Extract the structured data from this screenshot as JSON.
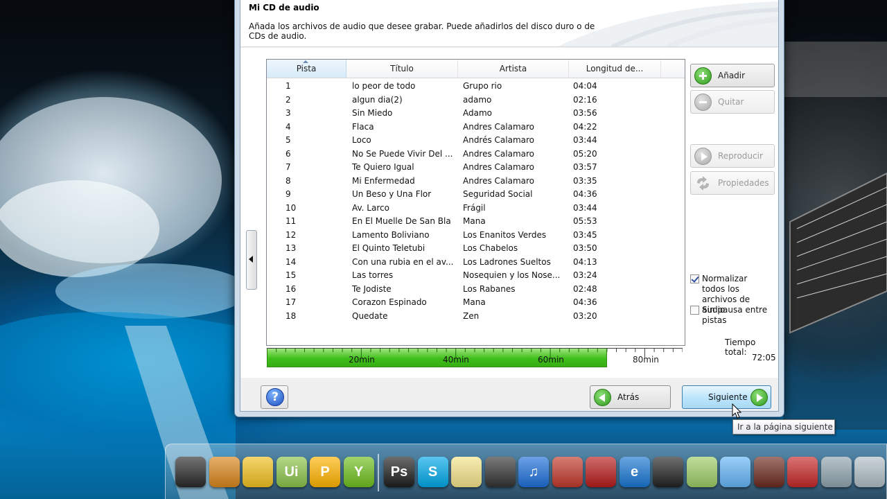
{
  "wizard": {
    "title": "Mi CD de audio",
    "description": "Añada los archivos de audio que desee grabar. Puede añadirlos del disco duro o de CDs de audio."
  },
  "track_list": {
    "columns": [
      "Pista",
      "Título",
      "Artista",
      "Longitud de..."
    ],
    "sorted_column": "Pista",
    "rows": [
      {
        "num": "1",
        "title": "lo peor de todo",
        "artist": "Grupo rio",
        "length": "04:04"
      },
      {
        "num": "2",
        "title": "algun dia(2)",
        "artist": "adamo",
        "length": "02:16"
      },
      {
        "num": "3",
        "title": "Sin Miedo",
        "artist": "Adamo",
        "length": "03:56"
      },
      {
        "num": "4",
        "title": "Flaca",
        "artist": "Andres Calamaro",
        "length": "04:22"
      },
      {
        "num": "5",
        "title": "Loco",
        "artist": "Andrés Calamaro",
        "length": "03:44"
      },
      {
        "num": "6",
        "title": "No Se Puede Vivir Del ...",
        "artist": "Andres Calamaro",
        "length": "05:20"
      },
      {
        "num": "7",
        "title": "Te Quiero Igual",
        "artist": "Andres Calamaro",
        "length": "03:57"
      },
      {
        "num": "8",
        "title": "Mi Enfermedad",
        "artist": "Andres Calamaro",
        "length": "03:35"
      },
      {
        "num": "9",
        "title": "Un Beso y Una Flor",
        "artist": "Seguridad Social",
        "length": "04:36"
      },
      {
        "num": "10",
        "title": "Av. Larco",
        "artist": "Frágil",
        "length": "03:44"
      },
      {
        "num": "11",
        "title": "En El Muelle De San Bla",
        "artist": "Mana",
        "length": "05:53"
      },
      {
        "num": "12",
        "title": "Lamento Boliviano",
        "artist": "Los Enanitos Verdes",
        "length": "03:45"
      },
      {
        "num": "13",
        "title": "El Quinto Teletubi",
        "artist": "Los Chabelos",
        "length": "03:50"
      },
      {
        "num": "14",
        "title": "Con una rubia en el av...",
        "artist": "Los Ladrones Sueltos",
        "length": "04:13"
      },
      {
        "num": "15",
        "title": "Las torres",
        "artist": "Nosequien y los Nose...",
        "length": "03:24"
      },
      {
        "num": "16",
        "title": "Te Jodiste",
        "artist": "Los Rabanes",
        "length": "02:48"
      },
      {
        "num": "17",
        "title": "Corazon Espinado",
        "artist": "Mana",
        "length": "04:36"
      },
      {
        "num": "18",
        "title": "Quedate",
        "artist": "Zen",
        "length": "03:20"
      }
    ]
  },
  "capacity_bar": {
    "labels": [
      "20min",
      "40min",
      "60min",
      "80min"
    ],
    "total_minutes": 88,
    "used_minutes": 72.08,
    "fill_color": "#3fbf1a"
  },
  "side_buttons": {
    "add": "Añadir",
    "remove": "Quitar",
    "play": "Reproducir",
    "properties": "Propiedades"
  },
  "options": {
    "normalize_label": "Normalizar todos los archivos de audio",
    "normalize_checked": true,
    "no_gap_label": "Sin pausa entre pistas",
    "no_gap_checked": false
  },
  "total": {
    "label": "Tiempo total:",
    "value": "72:05"
  },
  "nav": {
    "back": "Atrás",
    "next": "Siguiente",
    "tooltip": "Ir a la página siguiente"
  },
  "dock": {
    "items": [
      {
        "name": "monitor-icon",
        "label": "",
        "color": "#2a2a2a"
      },
      {
        "name": "book-icon",
        "label": "",
        "color": "#d9861c"
      },
      {
        "name": "sunflower-icon",
        "label": "",
        "color": "#f0c020"
      },
      {
        "name": "app-ui-icon",
        "label": "Ui",
        "color": "#8bc34a"
      },
      {
        "name": "app-p-icon",
        "label": "P",
        "color": "#ffb300"
      },
      {
        "name": "app-network-icon",
        "label": "Y",
        "color": "#6fbf1f"
      },
      {
        "name": "photoshop-icon",
        "label": "Ps",
        "color": "#1e1e1e"
      },
      {
        "name": "skype-icon",
        "label": "S",
        "color": "#00a8e8"
      },
      {
        "name": "notes-icon",
        "label": "",
        "color": "#f4e38a"
      },
      {
        "name": "phone-icon",
        "label": "",
        "color": "#333333"
      },
      {
        "name": "itunes-icon",
        "label": "♫",
        "color": "#1e6fd9"
      },
      {
        "name": "dictionary-icon",
        "label": "",
        "color": "#c0392b"
      },
      {
        "name": "paint-icon",
        "label": "",
        "color": "#b71c1c"
      },
      {
        "name": "internet-explorer-icon",
        "label": "e",
        "color": "#1976d2"
      },
      {
        "name": "camera-icon",
        "label": "",
        "color": "#222222"
      },
      {
        "name": "note-paper-icon",
        "label": "",
        "color": "#9ccc65"
      },
      {
        "name": "address-card-icon",
        "label": "",
        "color": "#64b5f6"
      },
      {
        "name": "keyboard-icon",
        "label": "",
        "color": "#6d2b1f"
      },
      {
        "name": "people-icon",
        "label": "",
        "color": "#c62828"
      },
      {
        "name": "compass-icon",
        "label": "",
        "color": "#90a4ae"
      },
      {
        "name": "recycle-bin-icon",
        "label": "",
        "color": "#b0bec5"
      }
    ]
  }
}
